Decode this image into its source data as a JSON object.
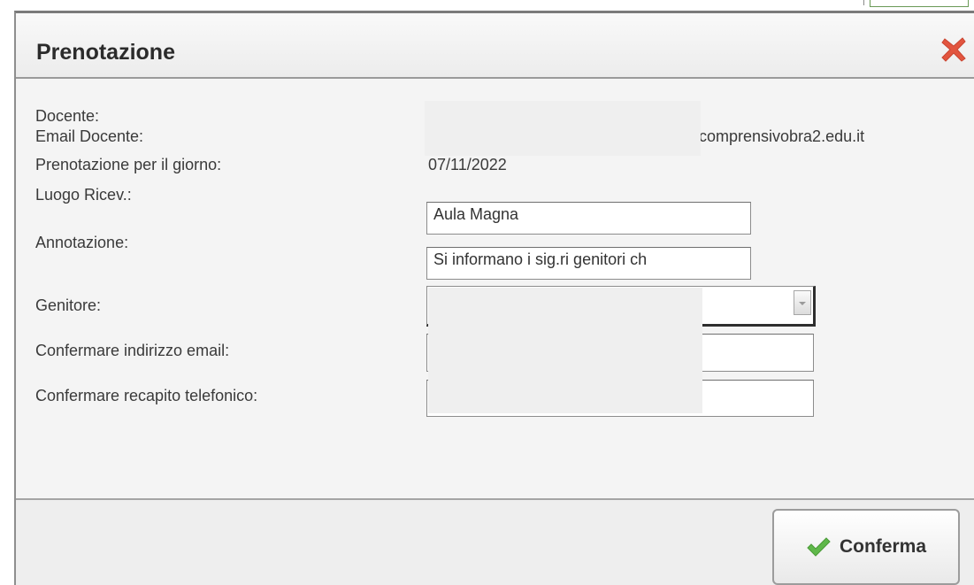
{
  "dialog": {
    "title": "Prenotazione"
  },
  "fields": {
    "docente": {
      "label": "Docente:"
    },
    "email_docente": {
      "label": "Email Docente:",
      "value_visible": "comprensivobra2.edu.it"
    },
    "giorno": {
      "label": "Prenotazione per il giorno:",
      "value": "07/11/2022"
    },
    "luogo": {
      "label": "Luogo Ricev.:",
      "value": "Aula Magna"
    },
    "annotazione": {
      "label": "Annotazione:",
      "value": "Si informano i sig.ri genitori ch"
    },
    "genitore": {
      "label": "Genitore:"
    },
    "conferma_email": {
      "label": "Confermare indirizzo email:"
    },
    "conferma_telefono": {
      "label": "Confermare recapito telefonico:"
    }
  },
  "footer": {
    "confirm_label": "Conferma"
  },
  "colors": {
    "close_icon": "#e2553f",
    "check_icon": "#5fb84a"
  },
  "icons": {
    "close": "close-icon",
    "check": "check-icon"
  }
}
